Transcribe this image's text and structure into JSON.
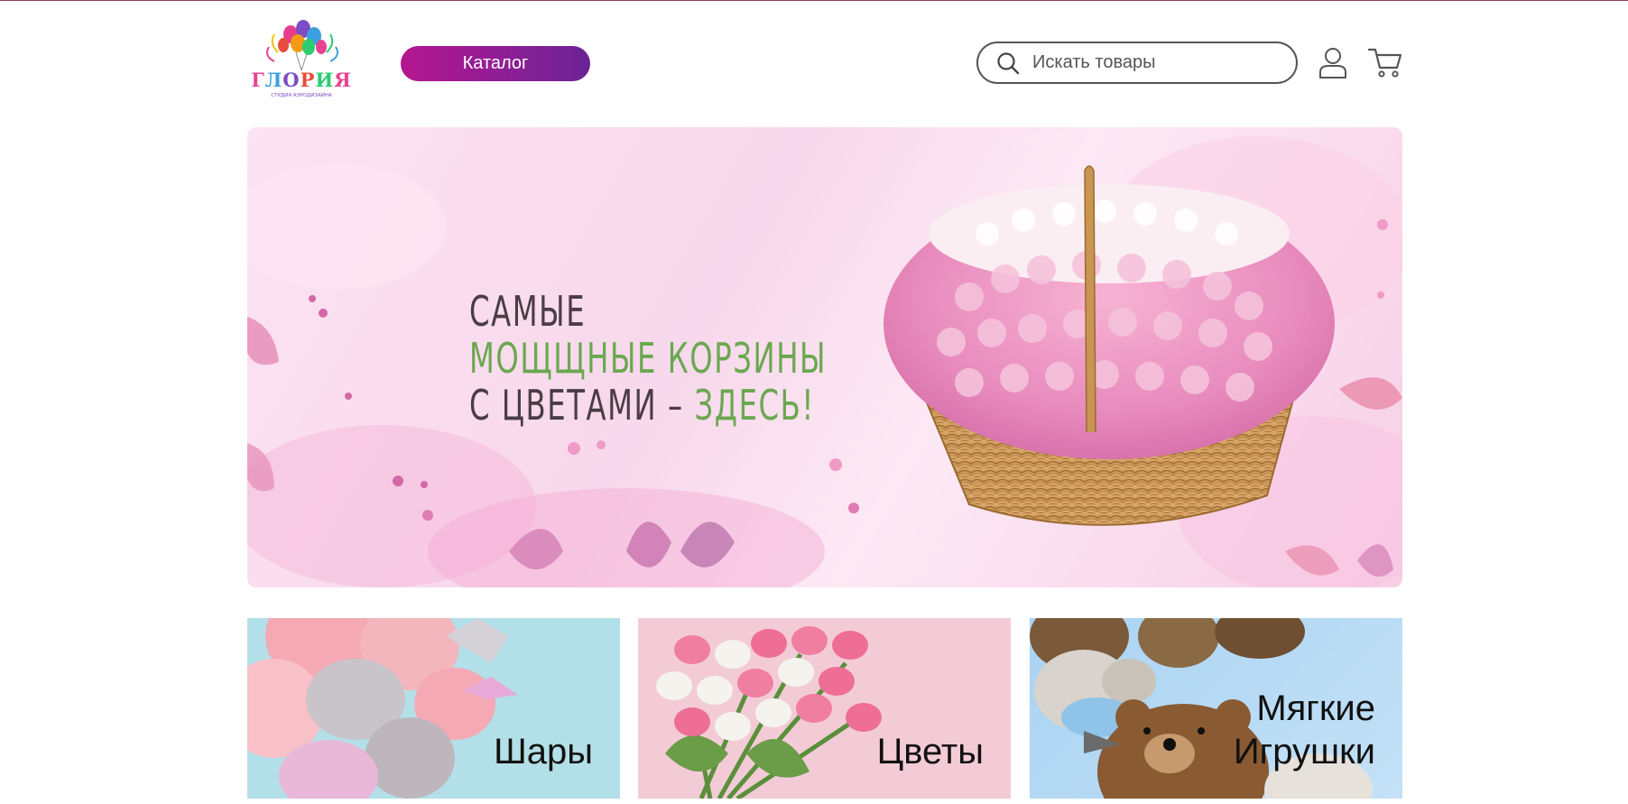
{
  "header": {
    "logo_text": "ГЛОРИЯ",
    "logo_subtext": "СТУДИЯ АЭРОДИЗАЙНА",
    "catalog_label": "Каталог",
    "search_placeholder": "Искать товары"
  },
  "banner": {
    "line1": "Самые",
    "line2": "мощщные корзины",
    "line3_a": "с цветами – ",
    "line3_b": "здесь!"
  },
  "categories": [
    {
      "label": "Шары"
    },
    {
      "label": "Цветы"
    },
    {
      "label_line1": "Мягкие",
      "label_line2": "Игрушки"
    }
  ],
  "colors": {
    "accent_gradient_start": "#b5168f",
    "accent_gradient_end": "#6a2395",
    "banner_text": "#4a3d44",
    "banner_green": "#6aa84f"
  },
  "icons": [
    "search-icon",
    "user-icon",
    "cart-icon"
  ]
}
